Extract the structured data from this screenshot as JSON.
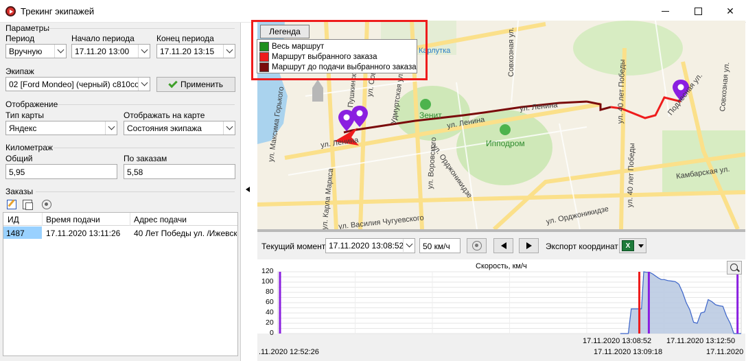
{
  "window": {
    "title": "Трекинг экипажей"
  },
  "params": {
    "section": "Параметры",
    "period_label": "Период",
    "period_value": "Вручную",
    "start_label": "Начало периода",
    "start_value": "17.11.20 13:00",
    "end_label": "Конец периода",
    "end_value": "17.11.20 13:15",
    "crew_label": "Экипаж",
    "crew_value": "02 [Ford Mondeo] (черный) с810со",
    "apply_label": "Применить"
  },
  "display": {
    "section": "Отображение",
    "map_type_label": "Тип карты",
    "map_type_value": "Яндекс",
    "show_label": "Отображать на карте",
    "show_value": "Состояния экипажа"
  },
  "mileage": {
    "section": "Километраж",
    "total_label": "Общий",
    "total_value": "5,95",
    "orders_label": "По заказам",
    "orders_value": "5,58"
  },
  "orders": {
    "section": "Заказы",
    "columns": [
      "ИД",
      "Время подачи",
      "Адрес подачи"
    ],
    "rows": [
      {
        "id": "1487",
        "time": "17.11.2020 13:11:26",
        "address": "40 Лет Победы ул. /Ижевск/,"
      }
    ]
  },
  "map": {
    "legend_button": "Легенда",
    "legend_items": [
      {
        "label": "Весь маршрут",
        "color": "#1f8f1f"
      },
      {
        "label": "Маршрут выбранного заказа",
        "color": "#ee1c1c"
      },
      {
        "label": "Маршрут до подачи выбранного заказа",
        "color": "#7a0b0b"
      }
    ],
    "labels": {
      "karlutka": "Карлутка",
      "zenit": "Зенит",
      "ippodrom": "Ипподром",
      "lenina1": "ул. Ленина",
      "lenina2": "ул. Ленина",
      "lenina3": "ул. Ленина",
      "gorkogo": "ул. Максима Горького",
      "marksa": "ул. Карла Маркса",
      "chugu": "ул. Василия Чугуевского",
      "ordzh1": "ул. Орджоникидзе",
      "ordzh2": "ул. Орджоникидзе",
      "vorovskogo": "ул. Воровского",
      "kambarskaya": "Камбарская ул.",
      "pobedy1": "ул. 40 лет Победы",
      "pobedy2": "ул. 40 лет Победы",
      "sovkhoznaya1": "Совхозная ул.",
      "sovkhoznaya2": "Совхозная ул.",
      "podlesnaya": "Подлесная ул.",
      "udmurt": "Удмуртская ул.",
      "pushkinskaya": "Пушкинская ул.",
      "sovetskaya": "ул. Советская"
    }
  },
  "controls": {
    "current_label": "Текущий момент",
    "current_value": "17.11.2020 13:08:52",
    "speed_value": "50 км/ч",
    "export_label": "Экспорт координат",
    "excel_glyph": "X"
  },
  "chart_data": {
    "type": "area",
    "title": "Скорость, км/ч",
    "ylim": [
      0,
      120
    ],
    "y_ticks": [
      0,
      10,
      20,
      30,
      40,
      50,
      60,
      70,
      80,
      90,
      100,
      110,
      120
    ],
    "color": "#b7c8e0",
    "line_color": "#3a63c9",
    "x": [
      "13:08:00",
      "13:08:10",
      "13:08:22",
      "13:08:30",
      "13:08:38",
      "13:08:46",
      "13:08:52",
      "13:08:58",
      "13:09:04",
      "13:09:12",
      "13:09:20",
      "13:09:28",
      "13:09:36",
      "13:09:44",
      "13:09:52",
      "13:10:00",
      "13:10:10",
      "13:10:20",
      "13:10:30",
      "13:10:40",
      "13:10:50",
      "13:11:00",
      "13:11:10",
      "13:11:20",
      "13:11:30",
      "13:11:40",
      "13:11:50",
      "13:12:00",
      "13:12:10",
      "13:12:20",
      "13:12:30",
      "13:12:40",
      "13:12:50",
      "13:13:00",
      "13:13:10",
      "13:13:20",
      "13:13:30"
    ],
    "values": [
      0,
      0,
      0,
      48,
      48,
      48,
      48,
      48,
      120,
      119,
      119,
      116,
      112,
      108,
      105,
      105,
      103,
      102,
      101,
      96,
      80,
      60,
      46,
      22,
      20,
      40,
      42,
      66,
      62,
      56,
      54,
      53,
      34,
      20,
      0,
      0,
      0
    ],
    "markers": [
      {
        "at": "12:52:26",
        "color": "#8a1fe0"
      },
      {
        "at": "13:08:52",
        "color": "#ee1c1c"
      },
      {
        "at": "13:09:18",
        "color": "#8a1fe0"
      },
      {
        "at": "13:13:20",
        "color": "#8a1fe0"
      }
    ],
    "x_tick_labels": {
      "left": ".11.2020 12:52:26",
      "top": [
        "17.11.2020 13:08:52",
        "17.11.2020 13:12:50"
      ],
      "bottom": [
        "17.11.2020 13:09:18",
        "17.11.2020"
      ]
    }
  }
}
